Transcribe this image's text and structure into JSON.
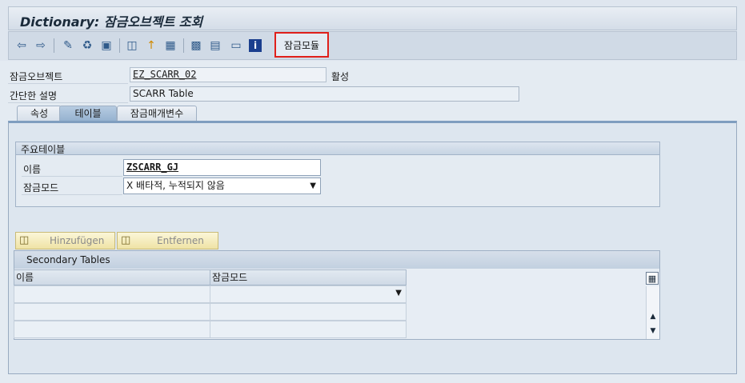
{
  "window": {
    "title": "Dictionary: 잠금오브젝트 조회"
  },
  "toolbar": {
    "icons": [
      "back-icon",
      "forward-icon",
      "other-object-icon",
      "display-change-icon",
      "activate-icon",
      "where-used-icon",
      "position-icon",
      "object-list-icon",
      "navigation-window-icon",
      "hierarchy-icon",
      "print-icon",
      "display-object-icon",
      "info-icon"
    ],
    "lock_module_label": "잠금모듈"
  },
  "header": {
    "lock_object_label": "잠금오브젝트",
    "lock_object_value": "EZ_SCARR_02",
    "status": "활성",
    "short_desc_label": "간단한 설명",
    "short_desc_value": "SCARR Table"
  },
  "tabs": [
    {
      "label": "속성",
      "active": false
    },
    {
      "label": "테이블",
      "active": true
    },
    {
      "label": "잠금매개변수",
      "active": false
    }
  ],
  "primary_table": {
    "group_title": "주요테이블",
    "name_label": "이름",
    "name_value": "ZSCARR_GJ",
    "lock_mode_label": "잠금모드",
    "lock_mode_value": "X 배타적, 누적되지 않음"
  },
  "buttons": {
    "add": "Hinzufügen",
    "remove": "Entfernen"
  },
  "secondary_tables": {
    "title": "Secondary Tables",
    "columns": [
      "이름",
      "잠금모드"
    ],
    "rows": [
      [
        "",
        ""
      ],
      [
        "",
        ""
      ],
      [
        "",
        ""
      ]
    ]
  },
  "colors": {
    "highlight": "#e0201b",
    "accent": "#2f5a8a"
  }
}
